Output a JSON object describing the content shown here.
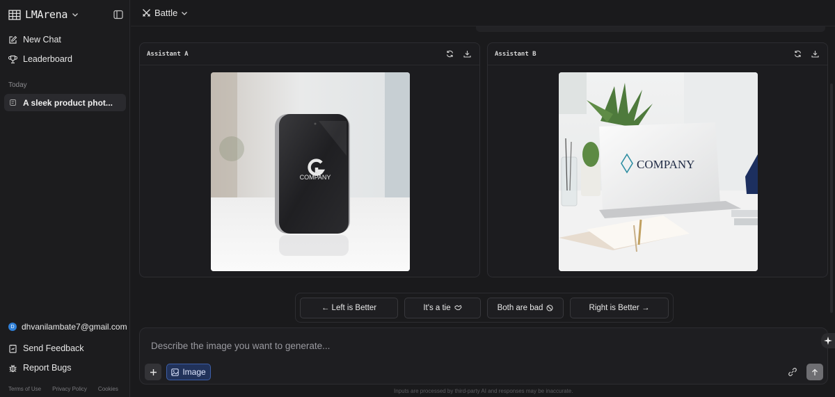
{
  "sidebar": {
    "brand": "LMArena",
    "nav": [
      {
        "label": "New Chat",
        "icon": "edit-icon"
      },
      {
        "label": "Leaderboard",
        "icon": "trophy-icon"
      }
    ],
    "section_label": "Today",
    "history": [
      {
        "label": "A sleek product phot..."
      }
    ],
    "user_email": "dhvanilambate7@gmail.com",
    "user_initial": "D",
    "bottom": [
      {
        "label": "Send Feedback",
        "icon": "feedback-icon"
      },
      {
        "label": "Report Bugs",
        "icon": "bug-icon"
      }
    ],
    "footer": [
      "Terms of Use",
      "Privacy Policy",
      "Cookies"
    ]
  },
  "topbar": {
    "mode": "Battle"
  },
  "panels": [
    {
      "title": "Assistant A",
      "logo_text": "COMPANY"
    },
    {
      "title": "Assistant B",
      "logo_text": "COMPANY"
    }
  ],
  "vote": {
    "left": "← Left is Better",
    "tie": "It's a tie",
    "bad": "Both are bad",
    "right": "Right is Better →"
  },
  "composer": {
    "placeholder": "Describe the image you want to generate...",
    "image_chip": "Image"
  },
  "disclaimer": "Inputs are processed by third-party AI and responses may be inaccurate.",
  "colors": {
    "accent": "#3d5fa8",
    "background": "#1a1a1c",
    "avatar": "#2f7fd6"
  }
}
